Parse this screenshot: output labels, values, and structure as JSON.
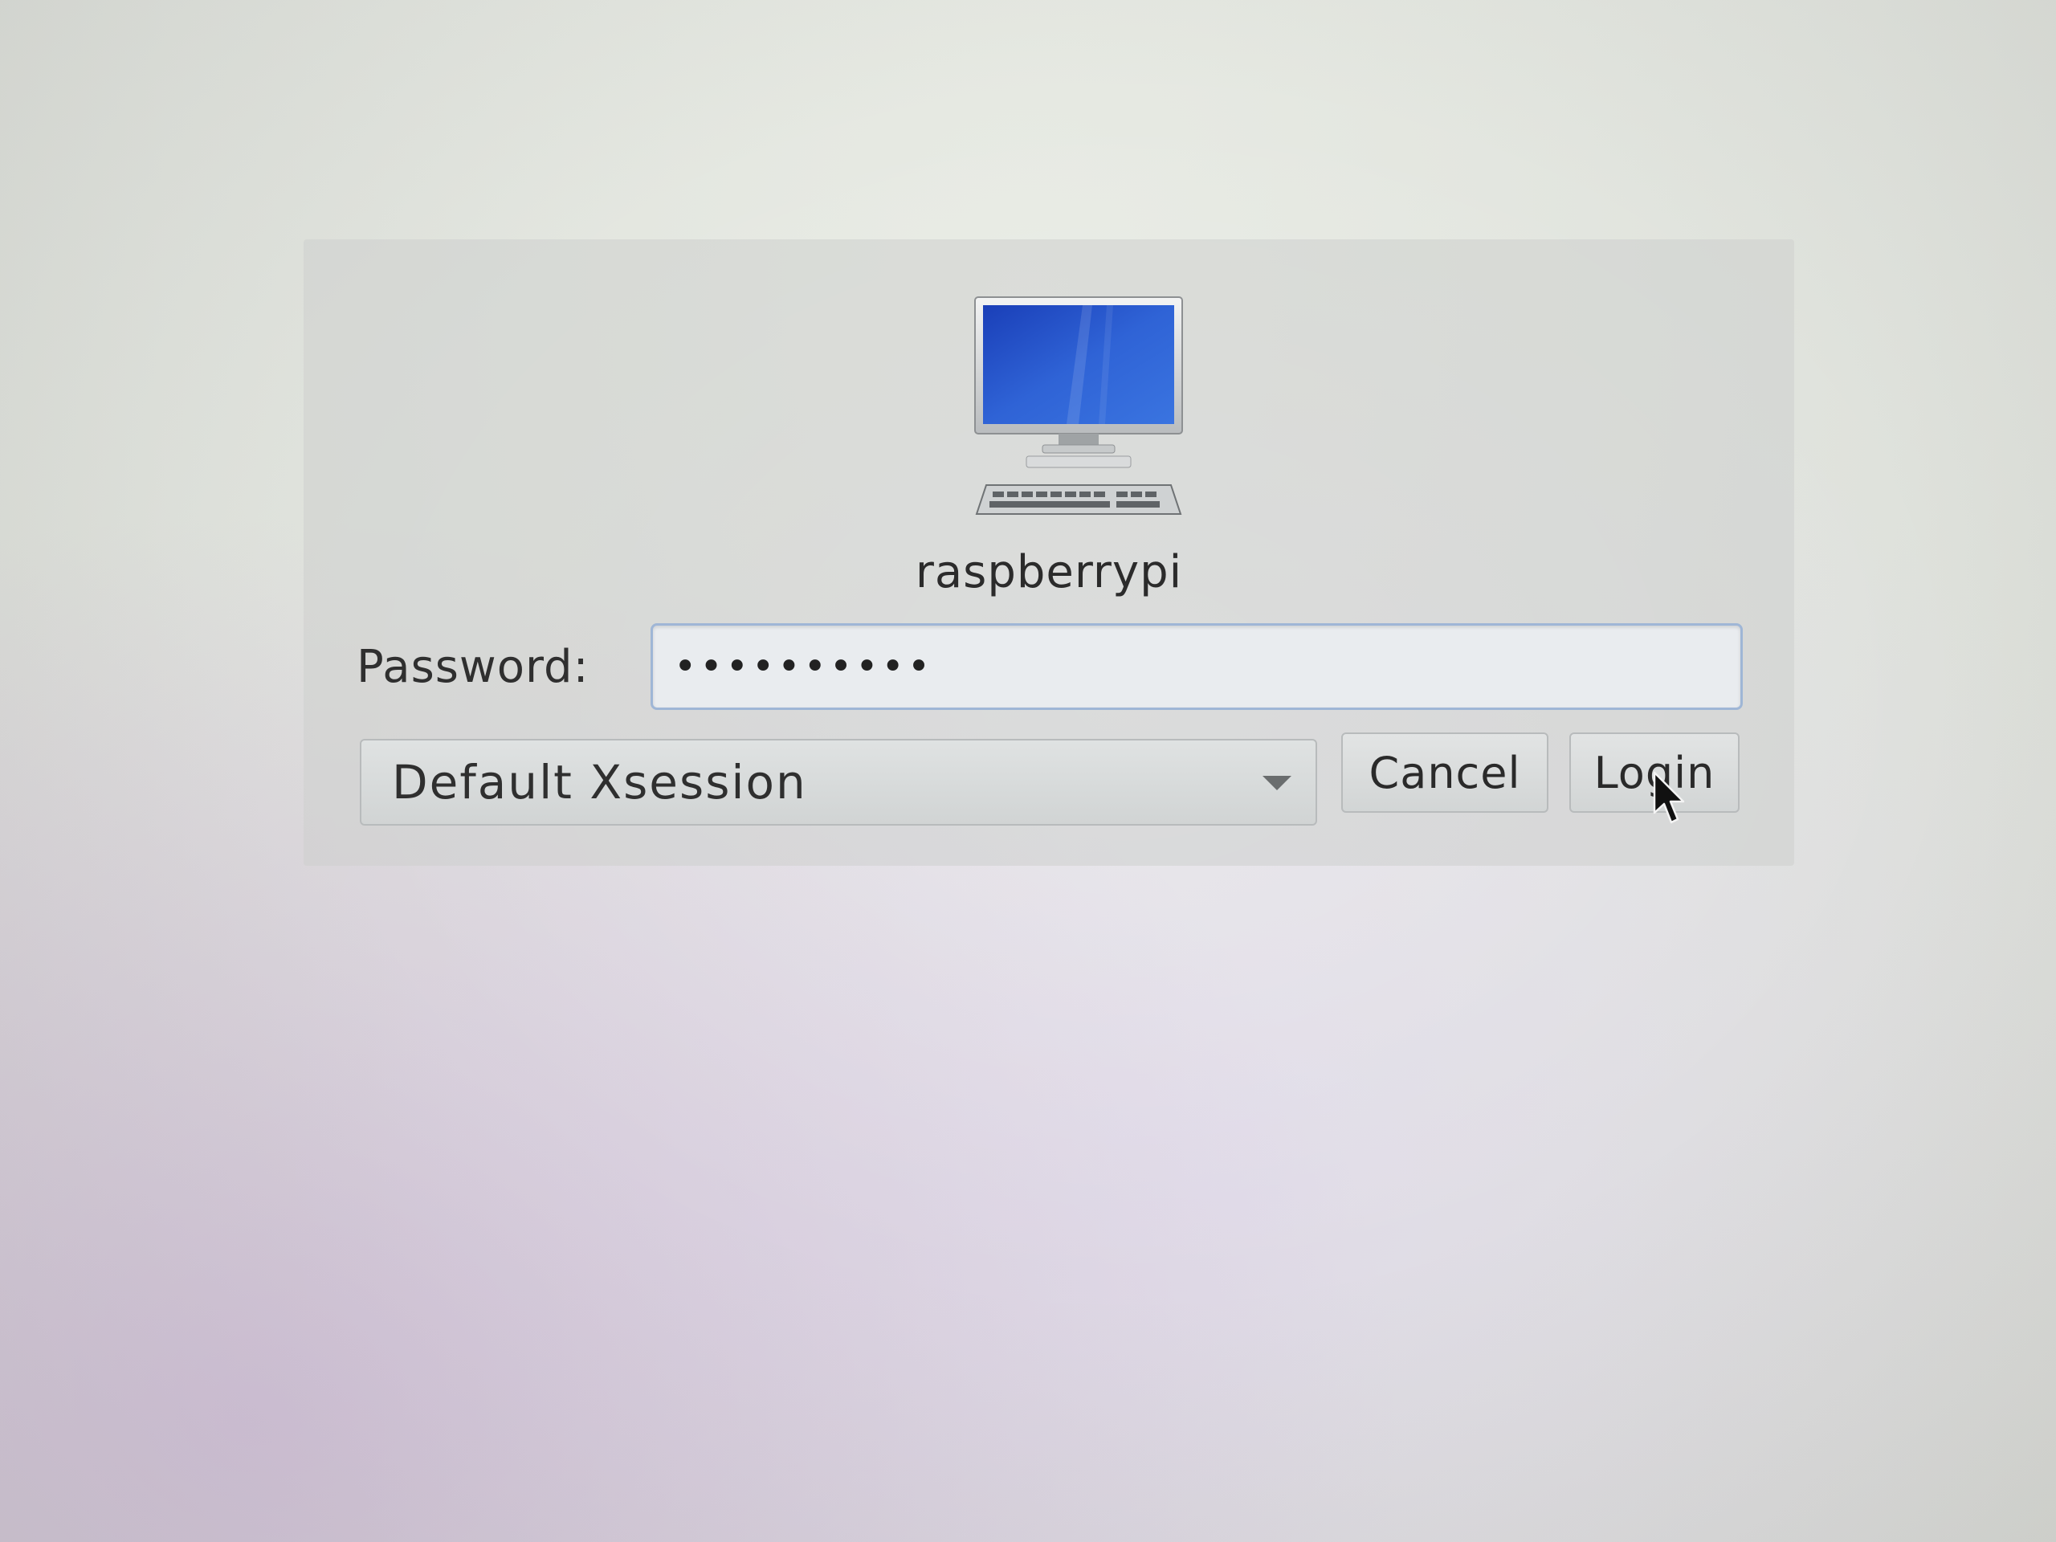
{
  "login": {
    "host_name": "raspberrypi",
    "password_label": "Password:",
    "password_value": "••••••••••",
    "session": "Default Xsession",
    "cancel_label": "Cancel",
    "login_label": "Login"
  },
  "icons": {
    "host": "computer-icon",
    "session_dropdown": "chevron-down-icon",
    "pointer": "mouse-cursor-icon"
  },
  "colors": {
    "screen_blue": "#2f5fd0",
    "focus_border": "#9fb6d6"
  }
}
